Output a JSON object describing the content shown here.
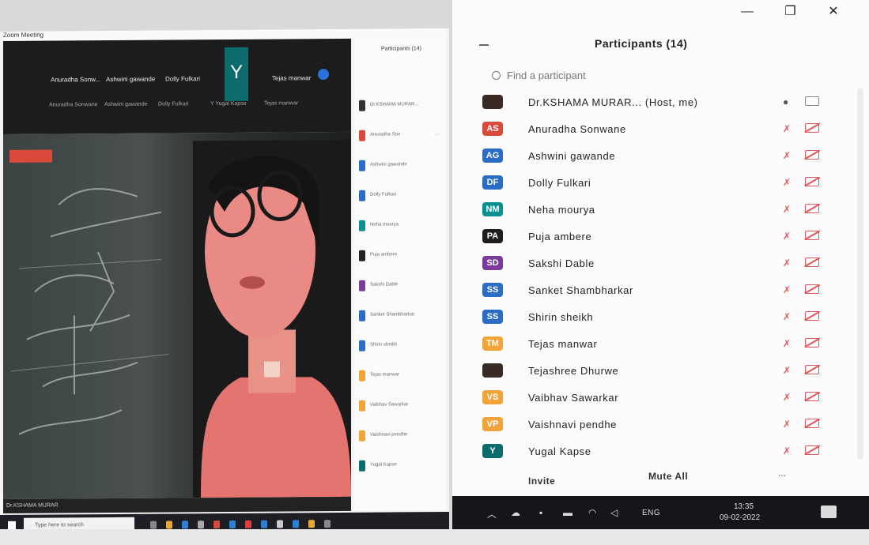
{
  "left_window": {
    "title": "Zoom Meeting",
    "speaker_strip": {
      "names": [
        "Anuradha Sonw...",
        "Ashwini gawande",
        "Dolly Fulkari",
        "Y",
        "Tejas manwar"
      ],
      "subs": [
        "Anuradha Sonwane",
        "Ashwini gawande",
        "Dolly Fulkari",
        "Y Yugal Kapse",
        "Tejas manwar"
      ]
    },
    "mini_panel_title": "Participants (14)",
    "bottom_status": "Dr.KSHAMA MURAR",
    "mini_participants": [
      {
        "name": "Dr.KSHAMA MURAR...",
        "color": "#333333"
      },
      {
        "name": "Anuradha Son",
        "color": "#d94a3a"
      },
      {
        "name": "Ashwini gawande",
        "color": "#2b6cc4"
      },
      {
        "name": "Dolly Fulkari",
        "color": "#2b6cc4"
      },
      {
        "name": "Neha mourya",
        "color": "#0c8f8f"
      },
      {
        "name": "Puja ambere",
        "color": "#222"
      },
      {
        "name": "Sakshi Dable",
        "color": "#7a3b9c"
      },
      {
        "name": "Sanket Shambharkar",
        "color": "#2b6cc4"
      },
      {
        "name": "Shirin sheikh",
        "color": "#2b6cc4"
      },
      {
        "name": "Tejas manwar",
        "color": "#f0a43a"
      },
      {
        "name": "Vaibhav Sawarkar",
        "color": "#f0a43a"
      },
      {
        "name": "Vaishnavi pendhe",
        "color": "#f0a43a"
      },
      {
        "name": "Yugal Kapse",
        "color": "#0c6b6b"
      }
    ],
    "taskbar_search": "Type here to search"
  },
  "participants_panel": {
    "title": "Participants (14)",
    "search_placeholder": "Find a participant",
    "participants": [
      {
        "initials": "",
        "name": "Dr.KSHAMA MURAR... (Host, me)",
        "color": "#3a2a24",
        "host": true
      },
      {
        "initials": "AS",
        "name": "Anuradha Sonwane",
        "color": "#d94a3a"
      },
      {
        "initials": "AG",
        "name": "Ashwini gawande",
        "color": "#2b6cc4"
      },
      {
        "initials": "DF",
        "name": "Dolly Fulkari",
        "color": "#2b6cc4"
      },
      {
        "initials": "NM",
        "name": "Neha mourya",
        "color": "#0c8f8f"
      },
      {
        "initials": "PA",
        "name": "Puja ambere",
        "color": "#1d1d1d"
      },
      {
        "initials": "SD",
        "name": "Sakshi Dable",
        "color": "#7a3b9c"
      },
      {
        "initials": "SS",
        "name": "Sanket Shambharkar",
        "color": "#2b6cc4"
      },
      {
        "initials": "SS",
        "name": "Shirin sheikh",
        "color": "#2b6cc4"
      },
      {
        "initials": "TM",
        "name": "Tejas manwar",
        "color": "#f0a43a"
      },
      {
        "initials": "",
        "name": "Tejashree Dhurwe",
        "color": "#3a2a24"
      },
      {
        "initials": "VS",
        "name": "Vaibhav Sawarkar",
        "color": "#f0a43a"
      },
      {
        "initials": "VP",
        "name": "Vaishnavi pendhe",
        "color": "#f0a43a"
      },
      {
        "initials": "Y",
        "name": "Yugal Kapse",
        "color": "#0c6b6b"
      }
    ],
    "invite_label": "Invite",
    "mute_all_label": "Mute All",
    "more_label": "..."
  },
  "taskbar": {
    "language": "ENG",
    "time": "13:35",
    "date": "09-02-2022"
  }
}
